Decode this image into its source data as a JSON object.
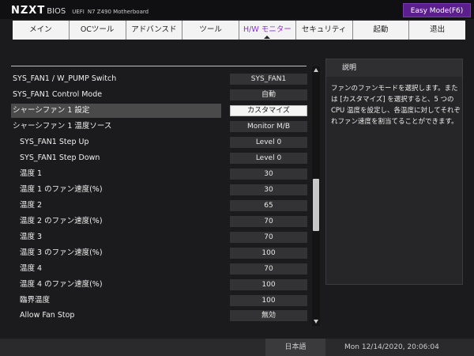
{
  "header": {
    "logo": "NZXT",
    "bios": "BIOS",
    "uefi": "UEFI",
    "board": "N7 Z490 Motherboard",
    "easy_mode": "Easy Mode(F6)"
  },
  "tabs": [
    {
      "label": "メイン"
    },
    {
      "label": "OCツール"
    },
    {
      "label": "アドバンスド"
    },
    {
      "label": "ツール"
    },
    {
      "label": "H/W モニター",
      "active": true
    },
    {
      "label": "セキュリティ"
    },
    {
      "label": "起動"
    },
    {
      "label": "退出"
    }
  ],
  "settings": [
    {
      "label": "SYS_FAN1 / W_PUMP Switch",
      "value": "SYS_FAN1"
    },
    {
      "label": "SYS_FAN1 Control Mode",
      "value": "自動"
    },
    {
      "label": "シャーシファン 1 設定",
      "value": "カスタマイズ",
      "selected": true
    },
    {
      "label": "シャーシファン 1 温度ソース",
      "value": "Monitor M/B"
    },
    {
      "label": "SYS_FAN1 Step Up",
      "value": "Level 0"
    },
    {
      "label": "SYS_FAN1 Step Down",
      "value": "Level 0"
    },
    {
      "label": "温度 1",
      "value": "30"
    },
    {
      "label": "温度 1 のファン速度(%)",
      "value": "30"
    },
    {
      "label": "温度 2",
      "value": "65"
    },
    {
      "label": "温度 2 のファン速度(%)",
      "value": "70"
    },
    {
      "label": "温度 3",
      "value": "70"
    },
    {
      "label": "温度 3 のファン速度(%)",
      "value": "100"
    },
    {
      "label": "温度 4",
      "value": "70"
    },
    {
      "label": "温度 4 のファン速度(%)",
      "value": "100"
    },
    {
      "label": "臨界温度",
      "value": "100"
    },
    {
      "label": "Allow Fan Stop",
      "value": "無効"
    }
  ],
  "help": {
    "title": "説明",
    "text": "ファンのファンモードを選択します。または [カスタマイズ] を選択すると、5 つの CPU 温度を設定し、各温度に対してそれぞれファン速度を割当てることができます。"
  },
  "footer": {
    "language": "日本語",
    "datetime": "Mon 12/14/2020, 20:06:04"
  },
  "colors": {
    "accent": "#8a35c8",
    "easy_mode_bg": "#5a1f8c",
    "background": "#1b1b1d"
  }
}
